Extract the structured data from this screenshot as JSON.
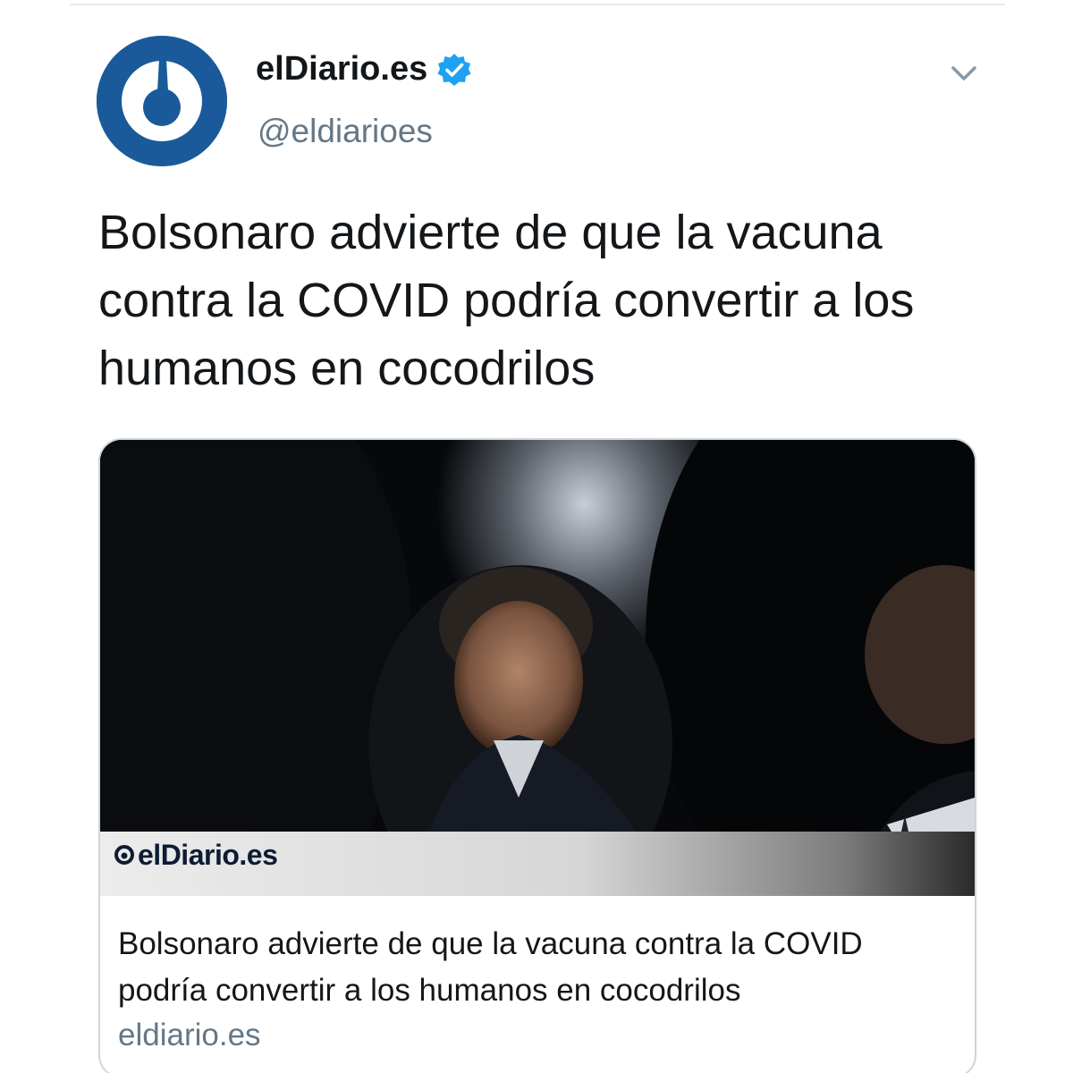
{
  "author": {
    "display_name": "elDiario.es",
    "handle": "@eldiarioes",
    "verified": true
  },
  "tweet": {
    "text": "Bolsonaro advierte de que la vacuna contra la COVID podría convertir a los humanos en cocodrilos"
  },
  "card": {
    "image_logo_text": "elDiario.es",
    "title": "Bolsonaro advierte de que la vacuna contra la COVID podría convertir a los humanos en cocodrilos",
    "domain": "eldiario.es"
  },
  "icons": {
    "verified": "verified-badge-icon",
    "caret": "chevron-down-icon"
  },
  "colors": {
    "brand_blue": "#1a5a9a",
    "verified_blue": "#1da1f2",
    "secondary_text": "#657786",
    "border": "#ccd6dd"
  }
}
